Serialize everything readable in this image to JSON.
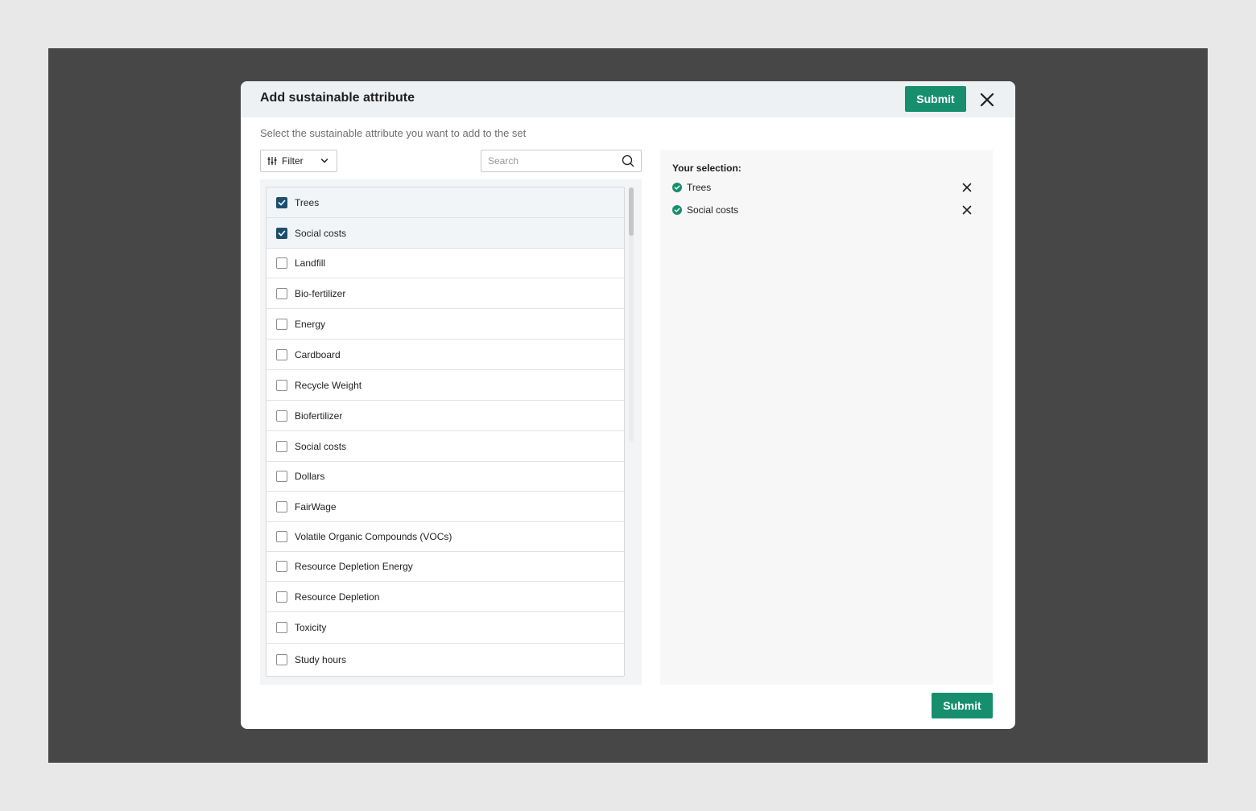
{
  "modal": {
    "title": "Add sustainable attribute",
    "submit_label": "Submit",
    "subtitle": "Select the sustainable attribute you want to add to the set"
  },
  "toolbar": {
    "filter_label": "Filter",
    "search_placeholder": "Search",
    "search_value": ""
  },
  "attributes": [
    {
      "label": "Trees",
      "checked": true
    },
    {
      "label": "Social costs",
      "checked": true
    },
    {
      "label": "Landfill",
      "checked": false
    },
    {
      "label": "Bio-fertilizer",
      "checked": false
    },
    {
      "label": "Energy",
      "checked": false
    },
    {
      "label": "Cardboard",
      "checked": false
    },
    {
      "label": "Recycle Weight",
      "checked": false
    },
    {
      "label": "Biofertilizer",
      "checked": false
    },
    {
      "label": "Social costs",
      "checked": false
    },
    {
      "label": "Dollars",
      "checked": false
    },
    {
      "label": "FairWage",
      "checked": false
    },
    {
      "label": "Volatile Organic Compounds (VOCs)",
      "checked": false
    },
    {
      "label": "Resource Depletion Energy",
      "checked": false
    },
    {
      "label": "Resource Depletion",
      "checked": false
    },
    {
      "label": "Toxicity",
      "checked": false
    },
    {
      "label": "Study hours",
      "checked": false
    }
  ],
  "selection": {
    "title": "Your selection:",
    "items": [
      "Trees",
      "Social costs"
    ]
  },
  "colors": {
    "primary": "#178f6f",
    "checkbox_checked": "#1d4e6e",
    "backdrop": "#474747"
  },
  "icons": {
    "close": "close-icon",
    "filter": "sliders-icon",
    "chevron": "chevron-down-icon",
    "search": "search-icon",
    "check": "check-circle-icon"
  }
}
